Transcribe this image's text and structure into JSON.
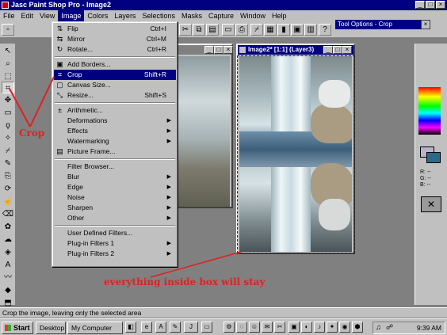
{
  "window": {
    "title": "Jasc Paint Shop Pro - Image2"
  },
  "menubar": [
    "File",
    "Edit",
    "View",
    "Image",
    "Colors",
    "Layers",
    "Selections",
    "Masks",
    "Capture",
    "Window",
    "Help"
  ],
  "tool_options": {
    "title": "Tool Options - Crop"
  },
  "image_window": {
    "title": "Image2* [1:1] (Layer3)"
  },
  "image_menu": {
    "items": [
      {
        "label": "Flip",
        "shortcut": "Ctrl+I",
        "icon": "flip-icon"
      },
      {
        "label": "Mirror",
        "shortcut": "Ctrl+M",
        "icon": "mirror-icon"
      },
      {
        "label": "Rotate...",
        "shortcut": "Ctrl+R",
        "icon": "rotate-icon"
      },
      {
        "label": "Add Borders...",
        "shortcut": "",
        "icon": "borders-icon"
      },
      {
        "label": "Crop",
        "shortcut": "Shift+R",
        "icon": "crop-icon"
      },
      {
        "label": "Canvas Size...",
        "shortcut": "",
        "icon": "canvas-icon"
      },
      {
        "label": "Resize...",
        "shortcut": "Shift+S",
        "icon": "resize-icon"
      },
      {
        "label": "Arithmetic...",
        "shortcut": "",
        "icon": "arithmetic-icon"
      },
      {
        "label": "Deformations",
        "shortcut": "",
        "submenu": true
      },
      {
        "label": "Effects",
        "shortcut": "",
        "submenu": true
      },
      {
        "label": "Watermarking",
        "shortcut": "",
        "submenu": true
      },
      {
        "label": "Picture Frame...",
        "shortcut": "",
        "icon": "frame-icon"
      },
      {
        "label": "Filter Browser...",
        "shortcut": ""
      },
      {
        "label": "Blur",
        "shortcut": "",
        "submenu": true
      },
      {
        "label": "Edge",
        "shortcut": "",
        "submenu": true
      },
      {
        "label": "Noise",
        "shortcut": "",
        "submenu": true
      },
      {
        "label": "Sharpen",
        "shortcut": "",
        "submenu": true
      },
      {
        "label": "Other",
        "shortcut": "",
        "submenu": true
      },
      {
        "label": "User Defined Filters...",
        "shortcut": ""
      },
      {
        "label": "Plug-in Filters 1",
        "shortcut": "",
        "submenu": true
      },
      {
        "label": "Plug-in Filters 2",
        "shortcut": "",
        "submenu": true
      }
    ],
    "highlighted": "Crop"
  },
  "annotations": {
    "crop_label": "Crop",
    "box_note": "everything inside box will stay"
  },
  "statusbar": {
    "text": "Crop the image, leaving only the selected area"
  },
  "taskbar": {
    "start": "Start",
    "items": [
      "Desktop",
      "My Computer"
    ],
    "clock": "9:39 AM"
  },
  "colors": {
    "titlebar": "#000080",
    "annotation": "#e02020",
    "menu_highlight": "#000080"
  }
}
